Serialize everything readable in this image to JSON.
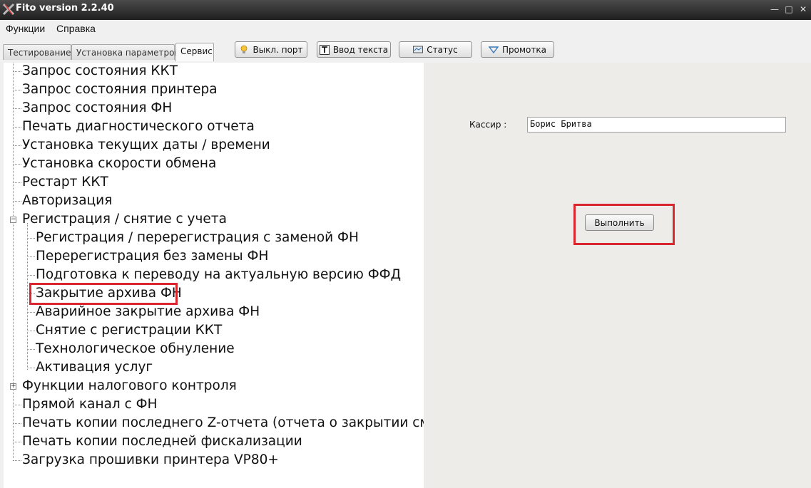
{
  "window": {
    "title": "Fito version 2.2.40"
  },
  "menu": [
    "Функции",
    "Справка"
  ],
  "tabs": [
    {
      "label": "Тестирование",
      "active": false
    },
    {
      "label": "Установка параметров",
      "active": false
    },
    {
      "label": "Сервис",
      "active": true
    }
  ],
  "toolbar": {
    "port_label": "Выкл. порт",
    "text_label": "Ввод текста",
    "status_label": "Статус",
    "feed_label": "Промотка"
  },
  "tree": {
    "items": [
      "Запрос состояния ККТ",
      "Запрос состояния принтера",
      "Запрос состояния ФН",
      "Печать диагностического отчета",
      "Установка текущих даты / времени",
      "Установка скорости обмена",
      "Рестарт ККТ",
      "Авторизация",
      "Регистрация / снятие с учета",
      "Функции налогового контроля",
      "Прямой канал с ФН",
      "Печать копии последнего Z-отчета (отчета о закрытии смены",
      "Печать копии последней фискализации",
      "Загрузка прошивки принтера VP80+"
    ],
    "registration_children": [
      "Регистрация / перерегистрация с заменой ФН",
      "Перерегистрация без замены ФН",
      "Подготовка к переводу на актуальную версию ФФД",
      "Закрытие архива ФН",
      "Аварийное закрытие архива ФН",
      "Снятие с регистрации ККТ",
      "Технологическое обнуление",
      "Активация услуг"
    ],
    "selected": "Закрытие архива ФН"
  },
  "form": {
    "kassir_label": "Кассир :",
    "kassir_value": "Борис Бритва",
    "execute_label": "Выполнить"
  },
  "colors": {
    "highlight": "#d9262f",
    "right_panel": "#edece8",
    "titlebar": "#2b2b2b"
  }
}
